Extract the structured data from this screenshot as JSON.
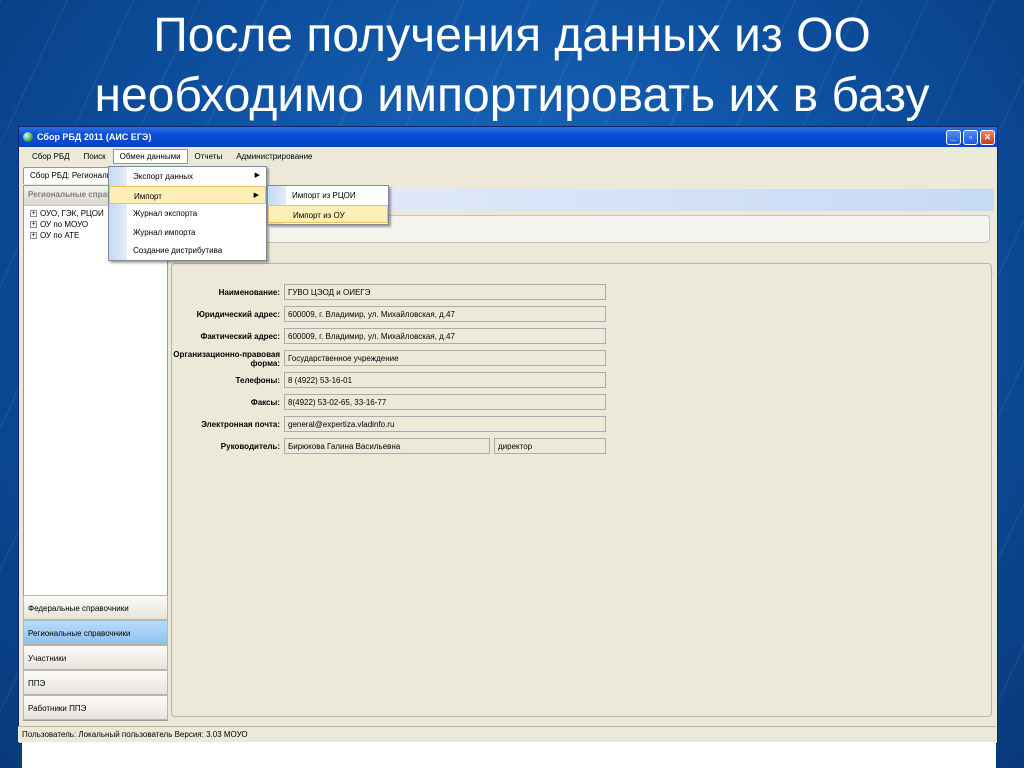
{
  "slide": {
    "title_line1": "После получения данных из ОО",
    "title_line2": "необходимо импортировать их в базу"
  },
  "window": {
    "title": "Сбор РБД 2011 (АИС ЕГЭ)",
    "minimize": "_",
    "restore": "▫",
    "close": "✕"
  },
  "menubar": {
    "items": [
      "Сбор РБД",
      "Поиск",
      "Обмен данными",
      "Отчеты",
      "Администрирование"
    ]
  },
  "doc_tab": "Сбор РБД: Региональные справочники",
  "left_panel": {
    "header": "Региональные справочники",
    "tree": [
      "ОУО, ГЭК, РЦОИ",
      "ОУ по МОУО",
      "ОУ по АТЕ"
    ],
    "buttons": [
      "Федеральные справочники",
      "Региональные справочники",
      "Участники",
      "ППЭ",
      "Работники ППЭ"
    ]
  },
  "exchange_menu": {
    "items": [
      "Экспорт данных",
      "Импорт",
      "Журнал экспорта",
      "Журнал импорта",
      "Создание дистрибутива"
    ]
  },
  "import_submenu": {
    "items": [
      "Импорт из РЦОИ",
      "Импорт из ОУ"
    ]
  },
  "details": {
    "name_label": "Наименование:",
    "name_value": "ГУВО ЦЭОД и ОИЕГЭ",
    "legal_addr_label": "Юридический адрес:",
    "legal_addr_value": "600009, г. Владимир, ул. Михайловская, д.47",
    "actual_addr_label": "Фактический адрес:",
    "actual_addr_value": "600009, г. Владимир, ул. Михайловская, д.47",
    "org_form_label": "Организационно-правовая форма:",
    "org_form_value": "Государственное учреждение",
    "phones_label": "Телефоны:",
    "phones_value": "8 (4922) 53-16-01",
    "faxes_label": "Факсы:",
    "faxes_value": "8(4922) 53-02-65, 33-16-77",
    "email_label": "Электронная почта:",
    "email_value": "general@expertiza.vladinfo.ru",
    "head_label": "Руководитель:",
    "head_value": "Бирюкова Галина Васильевна",
    "head_position": "директор"
  },
  "statusbar": {
    "text": "Пользователь: Локальный пользователь  Версия: 3.03   МОУО"
  }
}
